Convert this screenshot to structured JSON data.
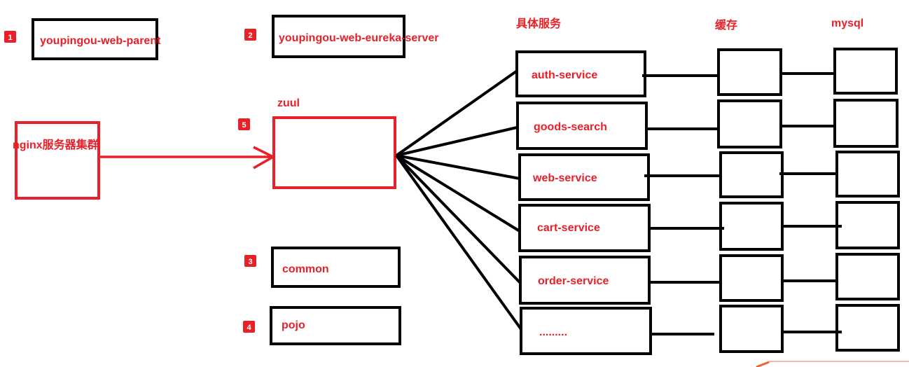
{
  "badges": [
    "1",
    "2",
    "3",
    "4",
    "5"
  ],
  "modules": {
    "parent": "youpingou-web-parent",
    "eureka": "youpingou-web-eureka-server",
    "common": "common",
    "pojo": "pojo"
  },
  "gateway": {
    "label": "zuul",
    "client_cluster": "nginx服务器集群"
  },
  "headers": {
    "services": "具体服务",
    "cache": "缓存",
    "db": "mysql"
  },
  "services": [
    "auth-service",
    "goods-search",
    "web-service",
    "cart-service",
    "order-service",
    "........."
  ],
  "colors": {
    "accent": "#e8202a",
    "line": "#000000",
    "badge": "#e8202a"
  }
}
